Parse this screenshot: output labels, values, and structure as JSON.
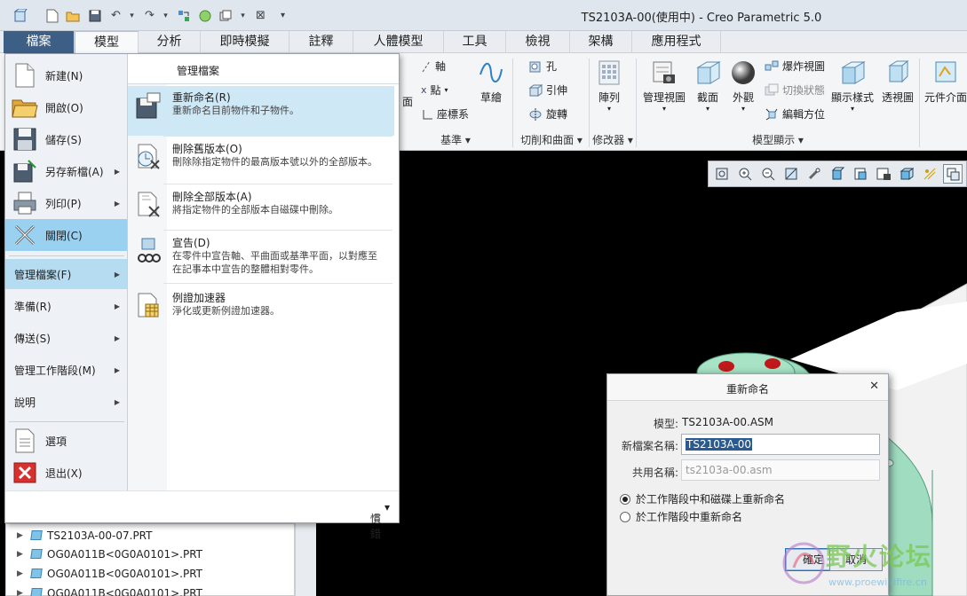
{
  "window": {
    "title": "TS2103A-00(使用中) - Creo Parametric 5.0"
  },
  "tabs": [
    {
      "label": "檔案"
    },
    {
      "label": "模型"
    },
    {
      "label": "分析"
    },
    {
      "label": "即時模擬"
    },
    {
      "label": "註釋"
    },
    {
      "label": "人體模型"
    },
    {
      "label": "工具"
    },
    {
      "label": "檢視"
    },
    {
      "label": "架構"
    },
    {
      "label": "應用程式"
    }
  ],
  "ribbon": {
    "plane_partial": "面",
    "axis": "軸",
    "point": "點",
    "csys": "座標系",
    "sketch": "草繪",
    "datum_group": "基準",
    "hole": "孔",
    "extrude": "引伸",
    "revolve": "旋轉",
    "cut_surface_group": "切削和曲面",
    "pattern": "陣列",
    "modifiers_group": "修改器",
    "manage_views": "管理視圖",
    "section": "截面",
    "appearance": "外觀",
    "explode_view": "爆炸視圖",
    "toggle_status": "切換狀態",
    "edit_position": "編輯方位",
    "display_style": "顯示樣式",
    "perspective": "透視圖",
    "model_display_group": "模型顯示",
    "component_interface": "元件介面"
  },
  "file_menu": {
    "items": [
      {
        "label": "新建(N)"
      },
      {
        "label": "開啟(O)"
      },
      {
        "label": "儲存(S)"
      },
      {
        "label": "另存新檔(A)"
      },
      {
        "label": "列印(P)"
      },
      {
        "label": "關閉(C)"
      },
      {
        "label": "管理檔案(F)"
      },
      {
        "label": "準備(R)"
      },
      {
        "label": "傳送(S)"
      },
      {
        "label": "管理工作階段(M)"
      },
      {
        "label": "說明"
      },
      {
        "label": "選項"
      },
      {
        "label": "退出(X)"
      }
    ],
    "footer": "慣錯"
  },
  "manage_files": {
    "header": "管理檔案",
    "items": [
      {
        "title": "重新命名(R)",
        "desc": "重新命名目前物件和子物件。"
      },
      {
        "title": "刪除舊版本(O)",
        "desc": "刪除除指定物件的最高版本號以外的全部版本。"
      },
      {
        "title": "刪除全部版本(A)",
        "desc": "將指定物件的全部版本自磁碟中刪除。"
      },
      {
        "title": "宣告(D)",
        "desc": "在零件中宣告軸、平曲面或基準平面，以對應至在記事本中宣告的整體相對零件。"
      },
      {
        "title": "例證加速器",
        "desc": "淨化或更新例證加速器。"
      }
    ]
  },
  "model_tree": {
    "rows": [
      {
        "label": "TS2103A-00-07.PRT"
      },
      {
        "label": "OG0A011B<0G0A0101>.PRT"
      },
      {
        "label": "OG0A011B<0G0A0101>.PRT"
      },
      {
        "label": "OG0A011B<0G0A0101>.PRT"
      }
    ]
  },
  "rename_dialog": {
    "title": "重新命名",
    "model_label": "模型:",
    "model_value": "TS2103A-00.ASM",
    "new_name_label": "新檔案名稱:",
    "new_name_value": "TS2103A-00",
    "common_name_label": "共用名稱:",
    "common_name_value": "ts2103a-00.asm",
    "option1": "於工作階段中和磁碟上重新命名",
    "option2": "於工作階段中重新命名",
    "ok": "確定",
    "cancel": "取消"
  },
  "watermark": {
    "text": "野火论坛",
    "url": "www.proewildfire.cn"
  },
  "colors": {
    "file_tab": "#3d5f86",
    "menu_highlight": "#9bd1f0",
    "submenu_highlight": "#cfe8f6",
    "model_body": "#9fdcc0",
    "model_holes": "#c0191c"
  }
}
